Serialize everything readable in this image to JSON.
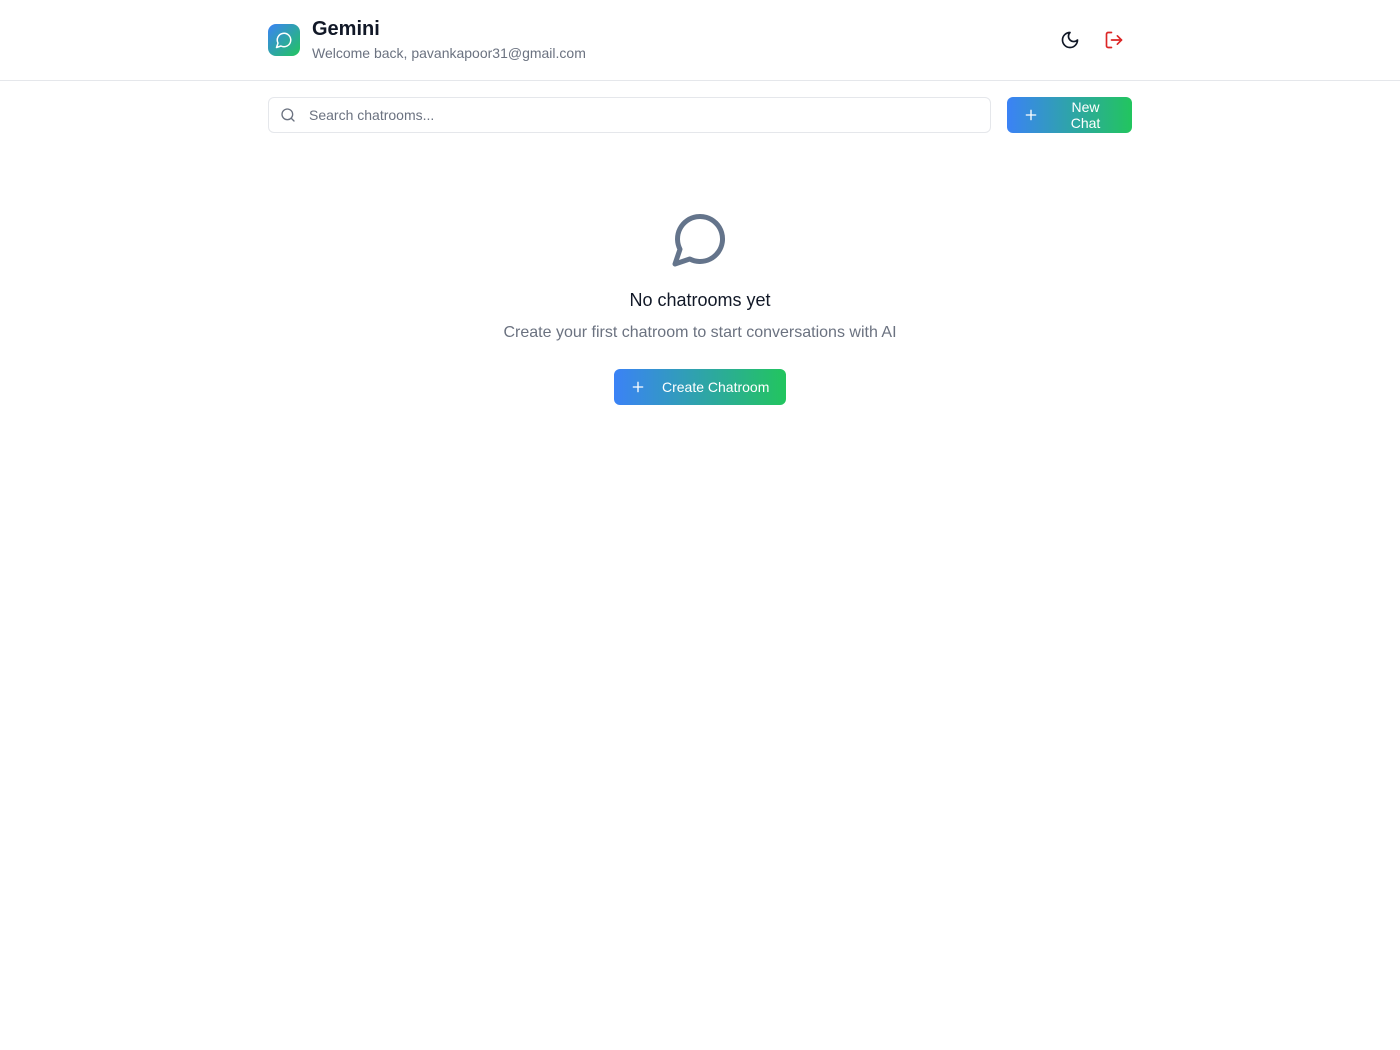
{
  "header": {
    "title": "Gemini",
    "welcome": "Welcome back, pavankapoor31@gmail.com",
    "logo_icon": "chat-bubble-icon",
    "theme_toggle_icon": "moon-icon",
    "logout_icon": "logout-icon"
  },
  "toolbar": {
    "search_placeholder": "Search chatrooms...",
    "new_chat_label": "New Chat"
  },
  "empty_state": {
    "icon": "chat-bubble-icon",
    "title": "No chatrooms yet",
    "description": "Create your first chatroom to start conversations with AI",
    "create_label": "Create Chatroom"
  },
  "colors": {
    "gradient_start": "#3b82f6",
    "gradient_end": "#22c55e",
    "logout": "#dc2626",
    "muted_text": "#6b7280",
    "border": "#e5e7eb"
  }
}
